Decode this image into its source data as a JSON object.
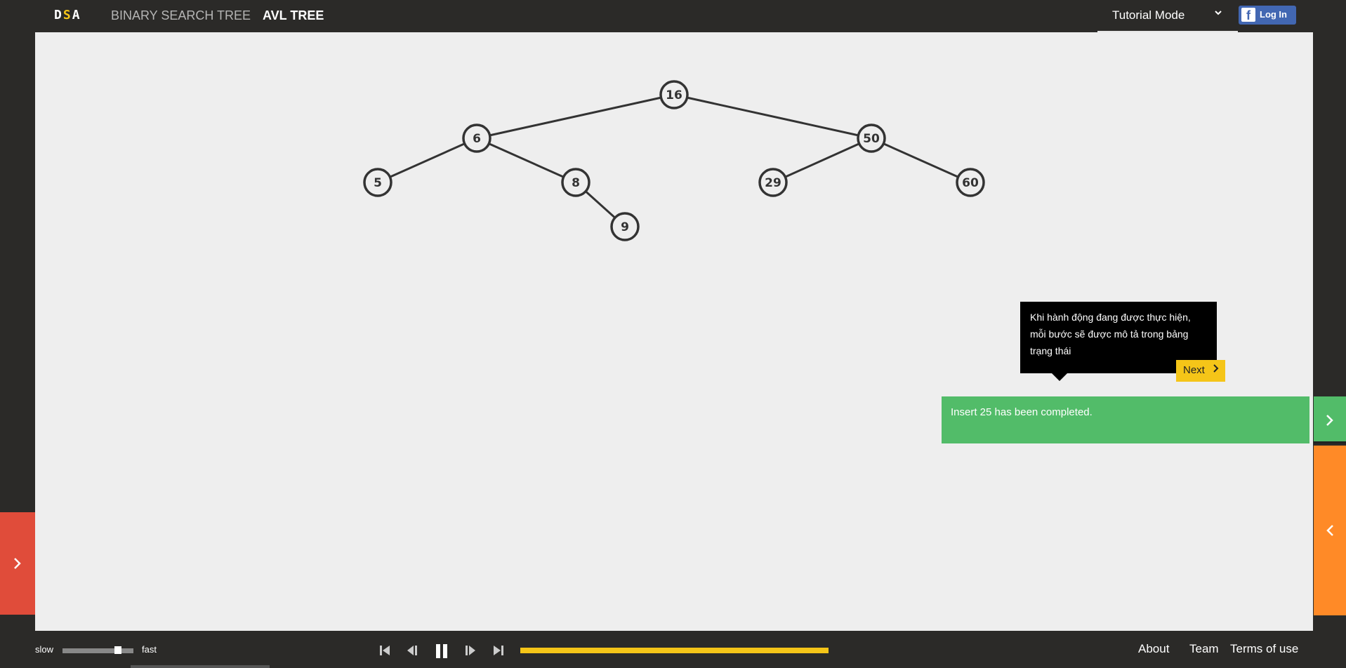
{
  "header": {
    "logo": {
      "prefix": "D",
      "middle": "S",
      "suffix": "A"
    },
    "nav": [
      {
        "label": "BINARY SEARCH TREE"
      },
      {
        "label": "AVL TREE"
      }
    ],
    "mode_select": {
      "value": "Tutorial Mode",
      "icon": "chevron-down-icon"
    },
    "login": {
      "icon": "facebook-icon",
      "icon_glyph": "f",
      "label": "Log In"
    }
  },
  "tree": {
    "nodes": [
      {
        "id": "n16",
        "value": "16"
      },
      {
        "id": "n6",
        "value": "6"
      },
      {
        "id": "n50",
        "value": "50"
      },
      {
        "id": "n5",
        "value": "5"
      },
      {
        "id": "n8",
        "value": "8"
      },
      {
        "id": "n9",
        "value": "9"
      },
      {
        "id": "n29",
        "value": "29"
      },
      {
        "id": "n60",
        "value": "60"
      }
    ],
    "edges": [
      [
        "n16",
        "n6"
      ],
      [
        "n16",
        "n50"
      ],
      [
        "n6",
        "n5"
      ],
      [
        "n6",
        "n8"
      ],
      [
        "n8",
        "n9"
      ],
      [
        "n50",
        "n29"
      ],
      [
        "n50",
        "n60"
      ]
    ]
  },
  "tutorial": {
    "text": "Khi hành động đang được thực hiện, mỗi bước sẽ được mô tả trong bảng trạng thái",
    "next_label": "Next"
  },
  "status": {
    "text": "Insert 25 has been completed."
  },
  "speed": {
    "slow_label": "slow",
    "fast_label": "fast",
    "level": 0.72
  },
  "playback": {
    "controls": [
      "go-to-start-icon",
      "step-backward-icon",
      "pause-icon",
      "step-forward-icon",
      "go-to-end-icon"
    ],
    "progress": 1.0
  },
  "footer": {
    "links": [
      {
        "label": "About"
      },
      {
        "label": "Team"
      },
      {
        "label": "Terms of use"
      }
    ]
  },
  "colors": {
    "accent": "#f5c518",
    "status_green": "#52bc69",
    "codetrace_orange": "#ff8a27",
    "actions_red": "#e04c3a",
    "facebook_blue": "#4267b2"
  }
}
